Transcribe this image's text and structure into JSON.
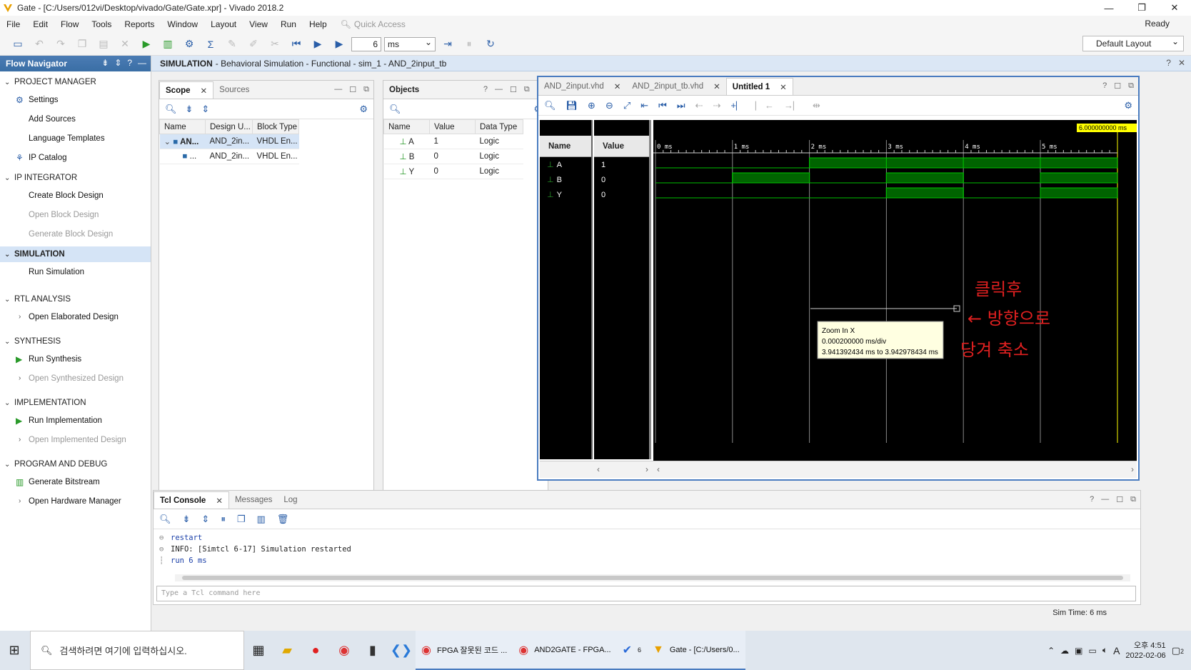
{
  "title_bar": {
    "title": "Gate - [C:/Users/012vi/Desktop/vivado/Gate/Gate.xpr] - Vivado 2018.2"
  },
  "menu": {
    "items": [
      "File",
      "Edit",
      "Flow",
      "Tools",
      "Reports",
      "Window",
      "Layout",
      "View",
      "Run",
      "Help"
    ],
    "quick_access": "Quick Access",
    "status": "Ready"
  },
  "toolbar": {
    "run_time_value": "6",
    "run_time_unit": "ms",
    "layout": "Default Layout"
  },
  "flow_navigator": {
    "title": "Flow Navigator",
    "sections": {
      "project_manager": {
        "label": "PROJECT MANAGER",
        "items": [
          "Settings",
          "Add Sources",
          "Language Templates",
          "IP Catalog"
        ]
      },
      "ip_integrator": {
        "label": "IP INTEGRATOR",
        "items": [
          "Create Block Design",
          "Open Block Design",
          "Generate Block Design"
        ]
      },
      "simulation": {
        "label": "SIMULATION",
        "items": [
          "Run Simulation"
        ]
      },
      "rtl_analysis": {
        "label": "RTL ANALYSIS",
        "items": [
          "Open Elaborated Design"
        ]
      },
      "synthesis": {
        "label": "SYNTHESIS",
        "items": [
          "Run Synthesis",
          "Open Synthesized Design"
        ]
      },
      "implementation": {
        "label": "IMPLEMENTATION",
        "items": [
          "Run Implementation",
          "Open Implemented Design"
        ]
      },
      "program_debug": {
        "label": "PROGRAM AND DEBUG",
        "items": [
          "Generate Bitstream",
          "Open Hardware Manager"
        ]
      }
    }
  },
  "sim_header": {
    "bold": "SIMULATION",
    "text": "- Behavioral Simulation - Functional - sim_1 - AND_2input_tb"
  },
  "scope": {
    "tabs": [
      "Scope",
      "Sources"
    ],
    "columns": [
      "Name",
      "Design U...",
      "Block Type"
    ],
    "rows": [
      [
        "AN...",
        "AND_2in...",
        "VHDL En..."
      ],
      [
        "...",
        "AND_2in...",
        "VHDL En..."
      ]
    ]
  },
  "objects": {
    "title": "Objects",
    "columns": [
      "Name",
      "Value",
      "Data Type"
    ],
    "rows": [
      [
        "A",
        "1",
        "Logic"
      ],
      [
        "B",
        "0",
        "Logic"
      ],
      [
        "Y",
        "0",
        "Logic"
      ]
    ]
  },
  "waveform": {
    "tabs": [
      "AND_2input.vhd",
      "AND_2input_tb.vhd",
      "Untitled 1"
    ],
    "name_header": "Name",
    "value_header": "Value",
    "signals": [
      {
        "name": "A",
        "value": "1"
      },
      {
        "name": "B",
        "value": "0"
      },
      {
        "name": "Y",
        "value": "0"
      }
    ],
    "cursor_time": "6.000000000 ms",
    "ticks": [
      "0 ms",
      "1 ms",
      "2 ms",
      "3 ms",
      "4 ms",
      "5 ms"
    ],
    "tooltip": {
      "line1": "Zoom In X",
      "line2": "0.000200000 ms/div",
      "line3": "3.941392434 ms to 3.942978434 ms"
    },
    "annotation": {
      "line1": "클릭후",
      "line2": "← 방향으로",
      "line3": "당겨 축소"
    },
    "trace_color": "#00c000",
    "annotation_color": "#e02020"
  },
  "tcl": {
    "tabs": [
      "Tcl Console",
      "Messages",
      "Log"
    ],
    "lines": [
      "restart",
      "INFO: [Simtcl 6-17] Simulation restarted",
      "run 6 ms"
    ],
    "placeholder": "Type a Tcl command here"
  },
  "status_bar": {
    "sim_time": "Sim Time: 6 ms"
  },
  "taskbar": {
    "search": "검색하려면 여기에 입력하십시오.",
    "apps": [
      "FPGA 잘못된 코드 ...",
      "AND2GATE - FPGA...",
      "Gate - [C:/Users/0..."
    ],
    "badge": "6",
    "time": "오후 4:51",
    "date": "2022-02-06",
    "ime": "A",
    "notifications": "2"
  }
}
